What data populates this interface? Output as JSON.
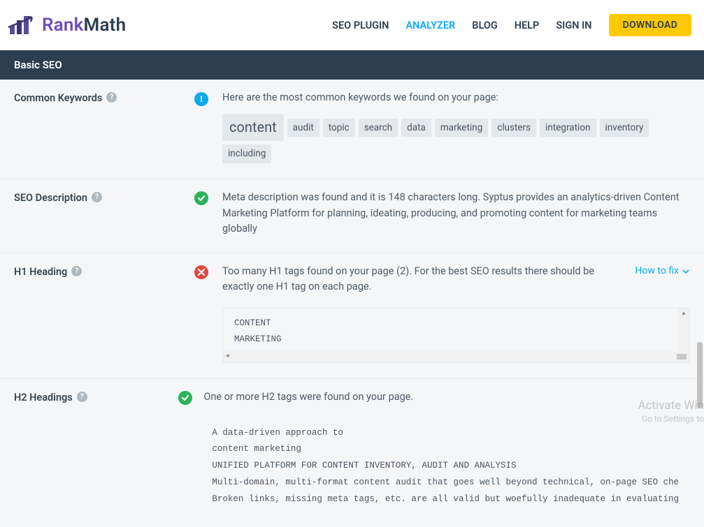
{
  "brand": {
    "rank": "Rank",
    "math": "Math"
  },
  "nav": {
    "seo_plugin": "SEO PLUGIN",
    "analyzer": "ANALYZER",
    "blog": "BLOG",
    "help": "HELP",
    "sign_in": "SIGN IN",
    "download": "DOWNLOAD"
  },
  "section": {
    "title": "Basic SEO"
  },
  "rows": {
    "keywords": {
      "label": "Common Keywords",
      "status": "info",
      "text": "Here are the most common keywords we found on your page:",
      "tags": [
        "content",
        "audit",
        "topic",
        "search",
        "data",
        "marketing",
        "clusters",
        "integration",
        "inventory",
        "including"
      ]
    },
    "description": {
      "label": "SEO Description",
      "status": "pass",
      "text": "Meta description was found and it is 148 characters long. Syptus provides an analytics-driven Content Marketing Platform for planning, ideating, producing, and promoting content for marketing teams globally"
    },
    "h1": {
      "label": "H1 Heading",
      "status": "fail",
      "text": "Too many H1 tags found on your page (2). For the best SEO results there should be exactly one H1 tag on each page.",
      "fix": "How to fix",
      "code": "CONTENT\nMARKETING"
    },
    "h2": {
      "label": "H2 Headings",
      "status": "pass",
      "text": "One or more H2 tags were found on your page.",
      "code": "A data-driven approach to\ncontent marketing\nUNIFIED PLATFORM FOR CONTENT INVENTORY, AUDIT AND ANALYSIS\nMulti-domain, multi-format content audit that goes well beyond technical, on-page SEO che\nBroken links, missing meta tags, etc. are all valid but woefully inadequate in evaluating"
    }
  },
  "watermark": {
    "title": "Activate Win",
    "sub": "Go to Settings to"
  }
}
